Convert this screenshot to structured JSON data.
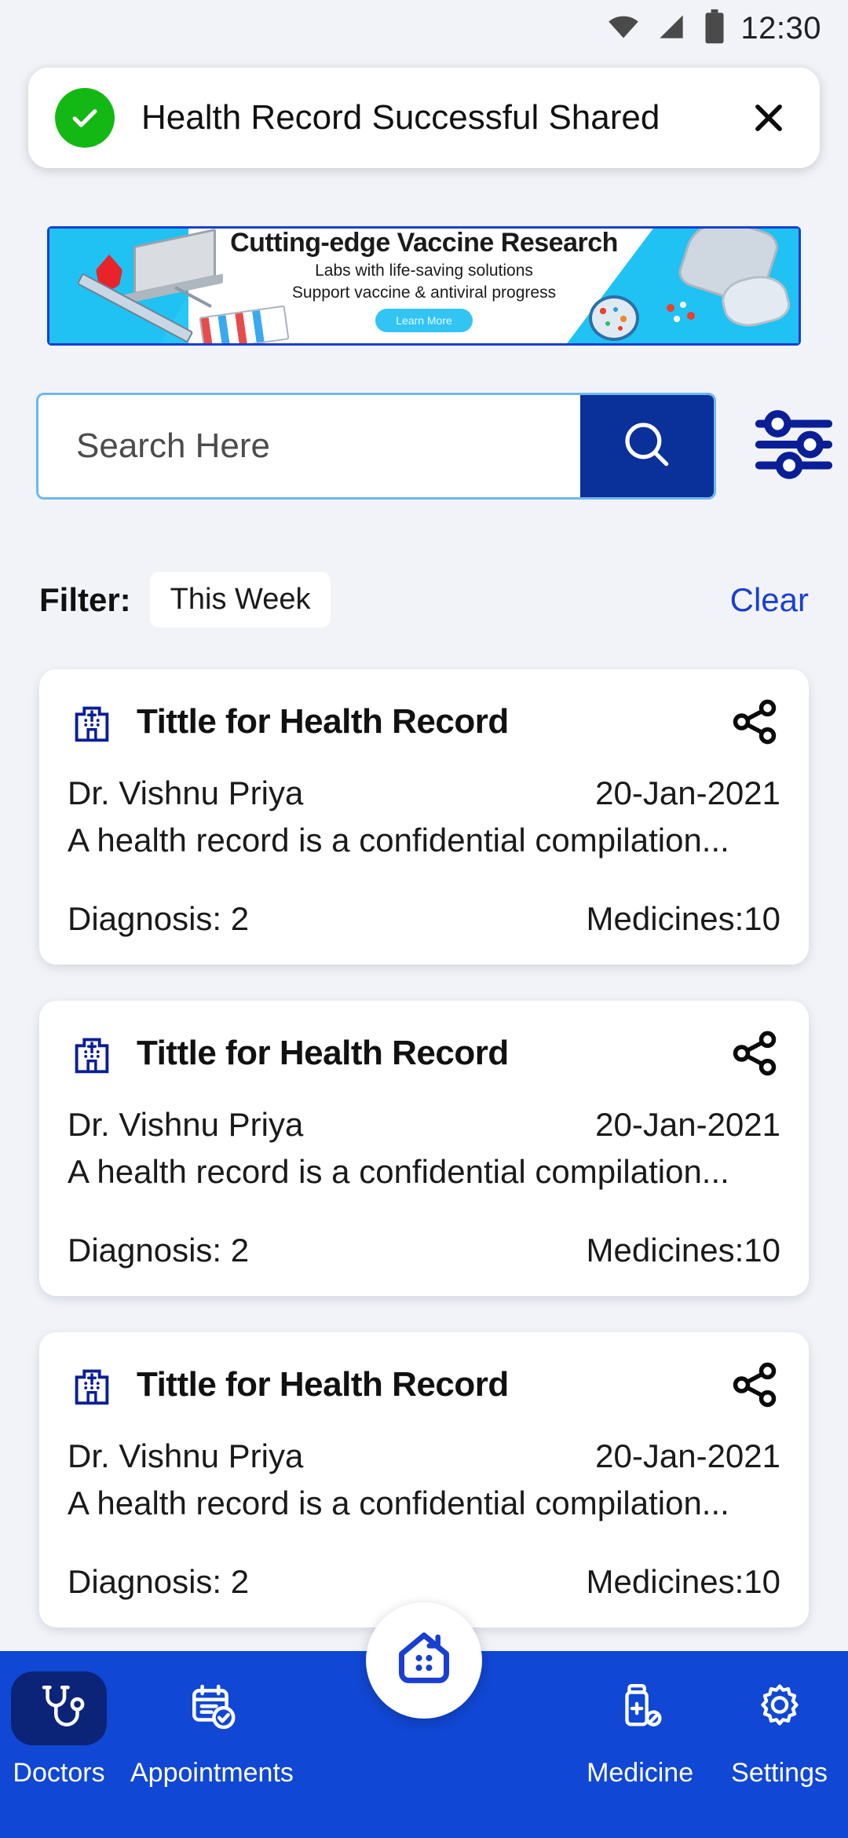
{
  "status_bar": {
    "time": "12:30",
    "icons": [
      "wifi-icon",
      "signal-icon",
      "battery-icon"
    ]
  },
  "toast": {
    "message": "Health Record Successful Shared",
    "icon": "success-check-icon",
    "close_label": "✕",
    "accent_color": "#14b814"
  },
  "banner_ad": {
    "headline": "Cutting-edge Vaccine Research",
    "line1": "Labs with life-saving solutions",
    "line2": "Support vaccine & antiviral progress",
    "cta": "Learn More",
    "background_color": "#27c8f5"
  },
  "search": {
    "placeholder": "Search Here",
    "value": "",
    "button_icon": "search-icon",
    "button_color": "#0a3099",
    "filter_icon": "sliders-icon"
  },
  "filter": {
    "label": "Filter:",
    "chip": "This Week",
    "clear": "Clear",
    "clear_color": "#1a3fd0"
  },
  "records": [
    {
      "title": "Tittle for Health Record",
      "doctor": "Dr. Vishnu Priya",
      "date": "20-Jan-2021",
      "description": "A health record is a confidential compilation...",
      "diagnosis": "Diagnosis: 2",
      "medicines": "Medicines:10",
      "icon": "hospital-icon",
      "share_icon": "share-icon"
    },
    {
      "title": "Tittle for Health Record",
      "doctor": "Dr. Vishnu Priya",
      "date": "20-Jan-2021",
      "description": "A health record is a confidential compilation...",
      "diagnosis": "Diagnosis: 2",
      "medicines": "Medicines:10",
      "icon": "hospital-icon",
      "share_icon": "share-icon"
    },
    {
      "title": "Tittle for Health Record",
      "doctor": "Dr. Vishnu Priya",
      "date": "20-Jan-2021",
      "description": "A health record is a confidential compilation...",
      "diagnosis": "Diagnosis: 2",
      "medicines": "Medicines:10",
      "icon": "hospital-icon",
      "share_icon": "share-icon"
    }
  ],
  "bottom_nav": {
    "background_color": "#1047d4",
    "active_pill_color": "#0c2478",
    "items": [
      {
        "label": "Doctors",
        "icon": "stethoscope-icon",
        "active": true
      },
      {
        "label": "Appointments",
        "icon": "clipboard-check-icon",
        "active": false
      },
      {
        "label": "Medicine",
        "icon": "medicine-bottle-icon",
        "active": false
      },
      {
        "label": "Settings",
        "icon": "gear-icon",
        "active": false
      }
    ],
    "fab": {
      "icon": "home-icon",
      "color": "#1a3fd0"
    }
  }
}
